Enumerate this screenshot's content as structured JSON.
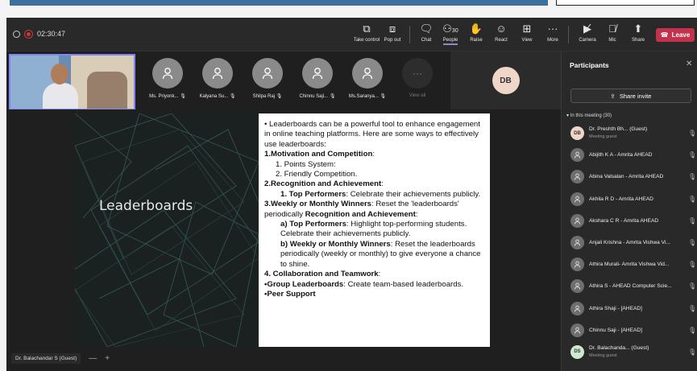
{
  "meeting": {
    "timer": "02:30:47"
  },
  "toolbar": {
    "buttons": [
      {
        "id": "take-control",
        "label": "Take control",
        "icon": "screen-control-icon"
      },
      {
        "id": "pop-out",
        "label": "Pop out",
        "icon": "pop-out-icon"
      },
      {
        "id": "chat",
        "label": "Chat",
        "icon": "chat-icon"
      },
      {
        "id": "people",
        "label": "People",
        "icon": "people-icon",
        "count": "30"
      },
      {
        "id": "raise",
        "label": "Raise",
        "icon": "hand-icon"
      },
      {
        "id": "react",
        "label": "React",
        "icon": "smiley-icon"
      },
      {
        "id": "view",
        "label": "View",
        "icon": "grid-icon"
      },
      {
        "id": "more",
        "label": "More",
        "icon": "more-icon"
      },
      {
        "id": "camera",
        "label": "Camera",
        "icon": "camera-off-icon"
      },
      {
        "id": "mic",
        "label": "Mic",
        "icon": "mic-off-icon"
      },
      {
        "id": "share",
        "label": "Share",
        "icon": "share-icon"
      }
    ],
    "leave_label": "Leave"
  },
  "tiles": [
    {
      "name": "Ms. Priyonk..."
    },
    {
      "name": "Kalyana Su..."
    },
    {
      "name": "Shilpa Raj"
    },
    {
      "name": "Chinnu Saji..."
    },
    {
      "name": "Ms.Saranya..."
    }
  ],
  "view_all_label": "View all",
  "db_initials": "DB",
  "slide": {
    "title": "Leaderboards",
    "intro": "• Leaderboards can be a powerful tool to enhance engagement in online teaching platforms. Here are some ways to effectively use leaderboards:",
    "h1": "1.Motivation and Competition",
    "h1_items": [
      "1. Points System:",
      "2. Friendly Competition."
    ],
    "h2": "2.Recognition and Achievement",
    "h2_item_bold": "1. Top Performers",
    "h2_item_text": ": Celebrate their achievements publicly.",
    "h3_bold": "3.Weekly or Monthly Winners",
    "h3_text": ": Reset the 'leaderboards' periodically ",
    "h3_bold2": "Recognition and Achievement",
    "a_bold": "a) Top Performers",
    "a_text": ": Highlight top-performing students. Celebrate their achievements publicly.",
    "b_bold": "b) Weekly or Monthly Winners",
    "b_text": ": Reset the leaderboards periodically (weekly or monthly) to give everyone a chance to shine.",
    "h4": "4. Collaboration and Teamwork",
    "g_bold": "•Group Leaderboards",
    "g_text": ": Create team-based leaderboards.",
    "peer": "•Peer Support"
  },
  "presenter_caption": "Dr. Balachandar S (Guest)",
  "panel": {
    "title": "Participants",
    "share_invite": "Share invite",
    "in_meeting": "In this meeting (30)",
    "people": [
      {
        "name": "Dr. Preshth Bh... (Guest)",
        "role": "Meeting guest",
        "initials": "DB",
        "mic": "mic-off-icon"
      },
      {
        "name": "Abijith K A - Amrita AHEAD",
        "mic": "mic-off-icon"
      },
      {
        "name": "Abina Valsalan - Amrita AHEAD",
        "mic": "mic-off-icon"
      },
      {
        "name": "Akhila R D - Amrita AHEAD",
        "mic": "mic-off-icon"
      },
      {
        "name": "Akshara C R - Amrita AHEAD",
        "mic": "mic-off-icon"
      },
      {
        "name": "Anjali Krishna - Amrita Vishwa Vi...",
        "mic": "mic-off-icon"
      },
      {
        "name": "Athira Murali- Amrita Vishwa Vid...",
        "mic": "mic-off-icon"
      },
      {
        "name": "Athira S - AHEAD Computer Scie...",
        "mic": "mic-off-icon"
      },
      {
        "name": "Athira Shaji - [AHEAD]",
        "mic": "mic-off-icon"
      },
      {
        "name": "Chinnu Saji - [AHEAD]",
        "mic": "mic-off-icon"
      },
      {
        "name": "Dr. Balachanda... (Guest)",
        "role": "Meeting guest",
        "initials": "DS",
        "mic": "mic-on-icon"
      }
    ]
  }
}
